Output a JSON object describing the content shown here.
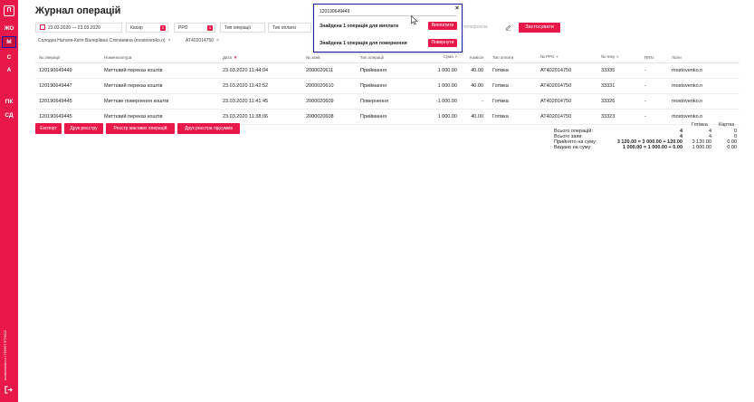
{
  "sidebar": {
    "logo": "П",
    "items": [
      {
        "label": "ЖО"
      },
      {
        "label": "М"
      },
      {
        "label": "С"
      },
      {
        "label": "А"
      },
      {
        "label": "ПК"
      },
      {
        "label": "СД"
      }
    ],
    "vertical_text": "mostovenko.n / ПФФП ФТ0012"
  },
  "page": {
    "title": "Журнал операцій"
  },
  "filters": {
    "date_range": "23.03.2020 — 23.03.2020",
    "cashier": "Касир",
    "cashier_badge": "1",
    "prro": "РРО",
    "prro_badge": "1",
    "operation_type": "Тип операції",
    "payment_type": "Тип оплати",
    "phone_placeholder": "телефоном",
    "apply_label": "Застосувати",
    "tags": [
      {
        "label": "Солодка Наталя-Катя Валеріївна Степанівна (mostovenko.n)"
      },
      {
        "label": "AT402014750"
      }
    ]
  },
  "table": {
    "columns": [
      "№ операції",
      "Номенклатура",
      "Дата",
      "№ заяв",
      "Тип операції",
      "Сума",
      "Комісія",
      "Тип оплати",
      "№ РРО",
      "№ чеку",
      "RRN",
      "Логін"
    ],
    "rows": [
      {
        "op": "120190649449",
        "name": "Миттєвий переказ коштів",
        "date": "23.03.2020 11:44:04",
        "req": "2000020611",
        "type": "Приймання",
        "sum": "1 000.00",
        "fee": "40.00",
        "pay": "Готівка",
        "rro": "AT402014750",
        "check": "33335",
        "rrn": "-",
        "login": "mostovenko.n"
      },
      {
        "op": "120190649447",
        "name": "Миттєвий переказ коштів",
        "date": "23.03.2020 11:42:52",
        "req": "2000020610",
        "type": "Приймання",
        "sum": "1 000.00",
        "fee": "40.00",
        "pay": "Готівка",
        "rro": "AT402014750",
        "check": "33331",
        "rrn": "-",
        "login": "mostovenko.n"
      },
      {
        "op": "120190649445",
        "name": "Миттєве повернення коштів",
        "date": "23.03.2020 11:41:45",
        "req": "2000020609",
        "type": "Повернення",
        "sum": "-1 000.00",
        "fee": "-",
        "pay": "Готівка",
        "rro": "AT402014750",
        "check": "33326",
        "rrn": "-",
        "login": "mostovenko.n"
      },
      {
        "op": "120190649445",
        "name": "Миттєвий переказ коштів",
        "date": "23.03.2020 11:38:06",
        "req": "2000020608",
        "type": "Приймання",
        "sum": "1 000.00",
        "fee": "40.00",
        "pay": "Готівка",
        "rro": "AT402014750",
        "check": "33323",
        "rrn": "-",
        "login": "mostovenko.n"
      }
    ]
  },
  "actions": {
    "export": "Експорт",
    "print_registry": "Друк реєстру",
    "mass_registry": "Реєстр масових операцій",
    "print_totals": "Друк реєстра підсумків"
  },
  "summary": {
    "col_cash": "Готівка",
    "col_card": "Картка",
    "rows": [
      {
        "label": "Всього операцій:",
        "total": "4",
        "cash": "4",
        "card": "0"
      },
      {
        "label": "Всього заяв:",
        "total": "4",
        "cash": "4",
        "card": "0"
      },
      {
        "label": "Прийнято на суму:",
        "total": "3 120.00 = 3 000.00 + 120.00",
        "cash": "3 120.00",
        "card": "0.00"
      },
      {
        "label": "Видано на суму:",
        "total": "1 000.00 = 1 000.00 + 0.00",
        "cash": "1 000.00",
        "card": "0.00"
      }
    ]
  },
  "popup": {
    "search_value": "120190649449",
    "payout_text": "Знайдена 1 операція для виплати",
    "payout_button": "Виплатити",
    "return_text": "Знайдена 1 операція для повернення",
    "return_button": "Повернути"
  },
  "colors": {
    "accent": "#e8194a",
    "highlight": "#1a1aa8"
  }
}
